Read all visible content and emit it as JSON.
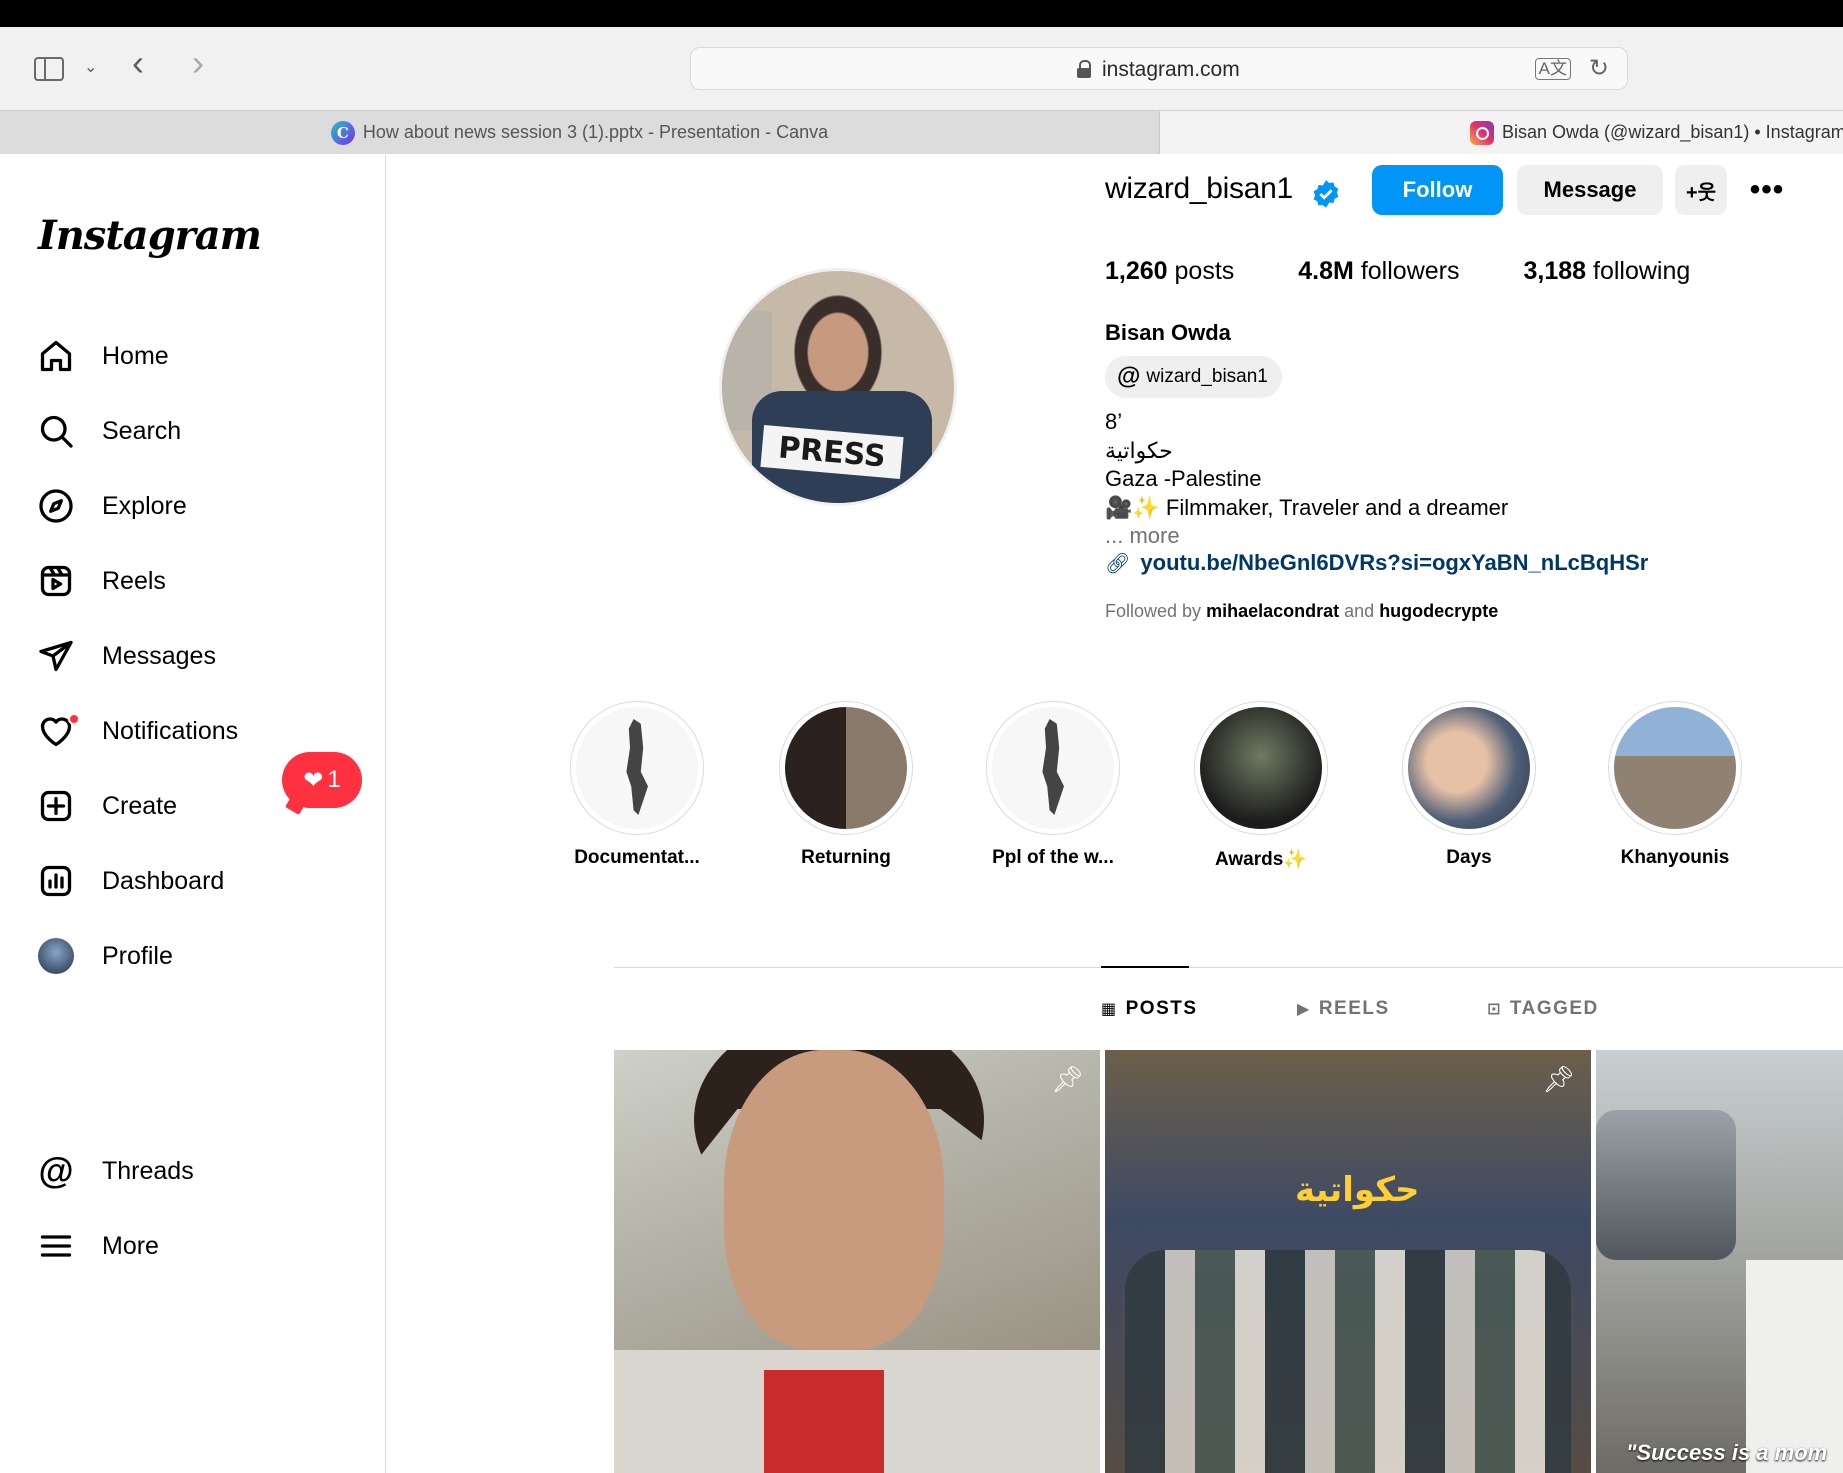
{
  "browser": {
    "url": "instagram.com",
    "tabs": [
      {
        "label": "How about news session 3 (1).pptx - Presentation - Canva",
        "icon": "canva-icon",
        "icon_glyph": "C"
      },
      {
        "label": "Bisan Owda (@wizard_bisan1) • Instagram",
        "icon": "instagram-icon"
      }
    ],
    "translate_icon": "translate-icon",
    "reload_icon": "reload-icon"
  },
  "sidebar": {
    "logo": "Instagram",
    "items": [
      {
        "label": "Home",
        "icon": "home-icon"
      },
      {
        "label": "Search",
        "icon": "search-icon"
      },
      {
        "label": "Explore",
        "icon": "compass-icon"
      },
      {
        "label": "Reels",
        "icon": "reels-icon"
      },
      {
        "label": "Messages",
        "icon": "send-icon"
      },
      {
        "label": "Notifications",
        "icon": "heart-icon"
      },
      {
        "label": "Create",
        "icon": "plus-square-icon"
      },
      {
        "label": "Dashboard",
        "icon": "chart-icon"
      },
      {
        "label": "Profile",
        "icon": "avatar"
      },
      {
        "label": "Threads",
        "icon": "threads-icon"
      },
      {
        "label": "More",
        "icon": "menu-icon"
      }
    ],
    "notification_badge": "1"
  },
  "profile": {
    "username": "wizard_bisan1",
    "verified": true,
    "follow_label": "Follow",
    "message_label": "Message",
    "add_user_glyph": "+웃",
    "more_glyph": "•••",
    "stats": {
      "posts_count": "1,260",
      "posts_label": "posts",
      "followers_count": "4.8M",
      "followers_label": "followers",
      "following_count": "3,188",
      "following_label": "following"
    },
    "full_name": "Bisan Owda",
    "threads_handle": "wizard_bisan1",
    "bio_lines": [
      "8’",
      "حكواتية",
      "Gaza -Palestine",
      "🎥✨ Filmmaker, Traveler and a dreamer"
    ],
    "more_label": "... more",
    "link": "youtu.be/NbeGnl6DVRs?si=ogxYaBN_nLcBqHSr",
    "followed_by_prefix": "Followed by",
    "followed_by_1": "mihaelacondrat",
    "followed_by_and": "and",
    "followed_by_2": "hugodecrypte",
    "profile_pic_text": "PRESS"
  },
  "highlights": [
    {
      "label": "Documentat..."
    },
    {
      "label": "Returning"
    },
    {
      "label": "Ppl of the w..."
    },
    {
      "label": "Awards✨"
    },
    {
      "label": "Days"
    },
    {
      "label": "Khanyounis"
    }
  ],
  "profile_tabs": [
    {
      "label": "POSTS",
      "icon": "grid-icon",
      "glyph": "▦",
      "active": true
    },
    {
      "label": "REELS",
      "icon": "reels-icon",
      "glyph": "▶",
      "active": false
    },
    {
      "label": "TAGGED",
      "icon": "tagged-icon",
      "glyph": "⊡",
      "active": false
    }
  ],
  "posts": {
    "post2_sign": "حكواتية",
    "post3_caption": "\"Success is a mom"
  },
  "colors": {
    "accent": "#0095f6",
    "notification": "#ff3040",
    "link": "#00376b"
  }
}
